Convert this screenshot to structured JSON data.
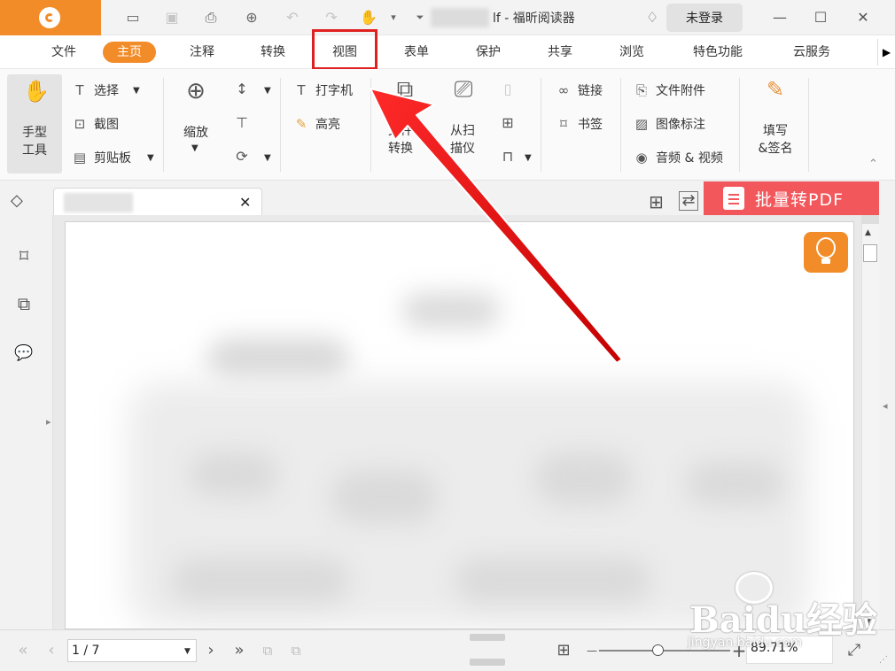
{
  "window": {
    "title_suffix": "lf - 福昕阅读器",
    "login_label": "未登录",
    "min_icon": "—",
    "max_icon": "☐",
    "close_icon": "✕",
    "brand_color": "#f28c28"
  },
  "quick_access": {
    "open_icon": "▭",
    "save_icon": "▣",
    "print_icon": "⎙",
    "new_icon": "⊕",
    "undo_icon": "↶",
    "redo_icon": "↷",
    "hand_icon": "✋",
    "dropdown_icon": "▾",
    "customize_icon": "⏷",
    "gift_icon": "♢"
  },
  "menu": {
    "tabs": [
      "文件",
      "主页",
      "注释",
      "转换",
      "视图",
      "表单",
      "保护",
      "共享",
      "浏览",
      "特色功能",
      "云服务"
    ],
    "active_tab": "主页",
    "more_icon": "▶"
  },
  "ribbon": {
    "hand_tool": "手型\n工具",
    "select": "选择",
    "screenshot": "截图",
    "clipboard": "剪贴板",
    "zoom": "缩放",
    "typewriter": "打字机",
    "highlight": "高亮",
    "file_convert": "文件\n转换",
    "from_scanner": "从扫\n描仪",
    "link": "链接",
    "bookmark": "书签",
    "file_attachment": "文件附件",
    "image_annotation": "图像标注",
    "audio_video": "音频 & 视频",
    "fill_sign": "填写\n&签名",
    "collapse_icon": "⌃"
  },
  "doc_tabs": {
    "close_icon": "✕",
    "batch_banner": "批量转PDF",
    "grid_icon": "⊞",
    "switch_icon": "⇄",
    "eraser_icon": "◇"
  },
  "sidebar": {
    "bookmark_icon": "⌑",
    "pages_icon": "⧉",
    "comments_icon": "💬",
    "expand_icon": "▸"
  },
  "status": {
    "first_icon": "«",
    "prev_icon": "‹",
    "page_value": "1 / 7",
    "next_icon": "›",
    "last_icon": "»",
    "zoom_value": "89.71%",
    "zoom_out_icon": "—",
    "zoom_in_icon": "+",
    "fit_icon": "⤢",
    "layout_icon": "⊞"
  },
  "watermark": {
    "brand": "Baidu经验",
    "url": "jingyan.baidu.com"
  }
}
